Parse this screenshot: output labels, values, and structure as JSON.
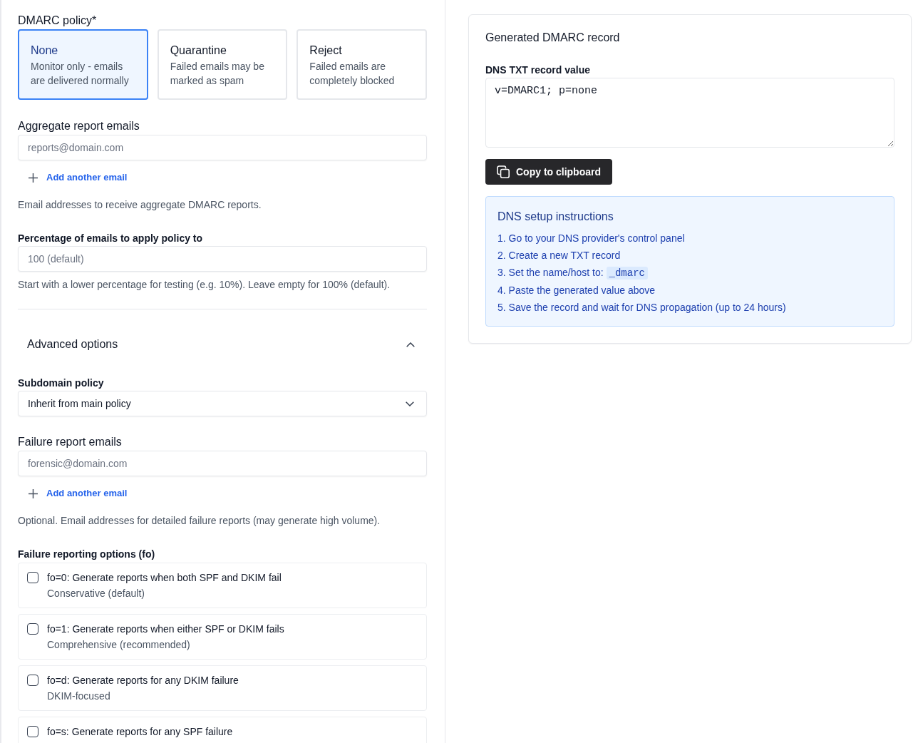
{
  "policy": {
    "label": "DMARC policy*",
    "options": [
      {
        "title": "None",
        "description": "Monitor only - emails are delivered normally",
        "selected": true
      },
      {
        "title": "Quarantine",
        "description": "Failed emails may be marked as spam",
        "selected": false
      },
      {
        "title": "Reject",
        "description": "Failed emails are completely blocked",
        "selected": false
      }
    ]
  },
  "aggregate_emails": {
    "label": "Aggregate report emails",
    "placeholder": "reports@domain.com",
    "add_link": "Add another email",
    "help": "Email addresses to receive aggregate DMARC reports."
  },
  "percentage": {
    "label": "Percentage of emails to apply policy to",
    "placeholder": "100 (default)",
    "help": "Start with a lower percentage for testing (e.g. 10%). Leave empty for 100% (default)."
  },
  "advanced": {
    "title": "Advanced options",
    "expanded": true,
    "subdomain_policy": {
      "label": "Subdomain policy",
      "value": "Inherit from main policy"
    },
    "failure_emails": {
      "label": "Failure report emails",
      "placeholder": "forensic@domain.com",
      "add_link": "Add another email",
      "help": "Optional. Email addresses for detailed failure reports (may generate high volume)."
    },
    "failure_options": {
      "label": "Failure reporting options (fo)",
      "options": [
        {
          "title": "fo=0: Generate reports when both SPF and DKIM fail",
          "subtitle": "Conservative (default)",
          "checked": false
        },
        {
          "title": "fo=1: Generate reports when either SPF or DKIM fails",
          "subtitle": "Comprehensive (recommended)",
          "checked": false
        },
        {
          "title": "fo=d: Generate reports for any DKIM failure",
          "subtitle": "DKIM-focused",
          "checked": false
        },
        {
          "title": "fo=s: Generate reports for any SPF failure",
          "checked": false
        }
      ]
    }
  },
  "record": {
    "title": "Generated DMARC record",
    "field_label": "DNS TXT record value",
    "value": "v=DMARC1; p=none",
    "copy_button": "Copy to clipboard",
    "instructions": {
      "title": "DNS setup instructions",
      "steps": [
        {
          "text": "1. Go to your DNS provider's control panel"
        },
        {
          "text": "2. Create a new TXT record"
        },
        {
          "text": "3. Set the name/host to:",
          "code": "_dmarc"
        },
        {
          "text": "4. Paste the generated value above"
        },
        {
          "text": "5. Save the record and wait for DNS propagation (up to 24 hours)"
        }
      ]
    }
  }
}
